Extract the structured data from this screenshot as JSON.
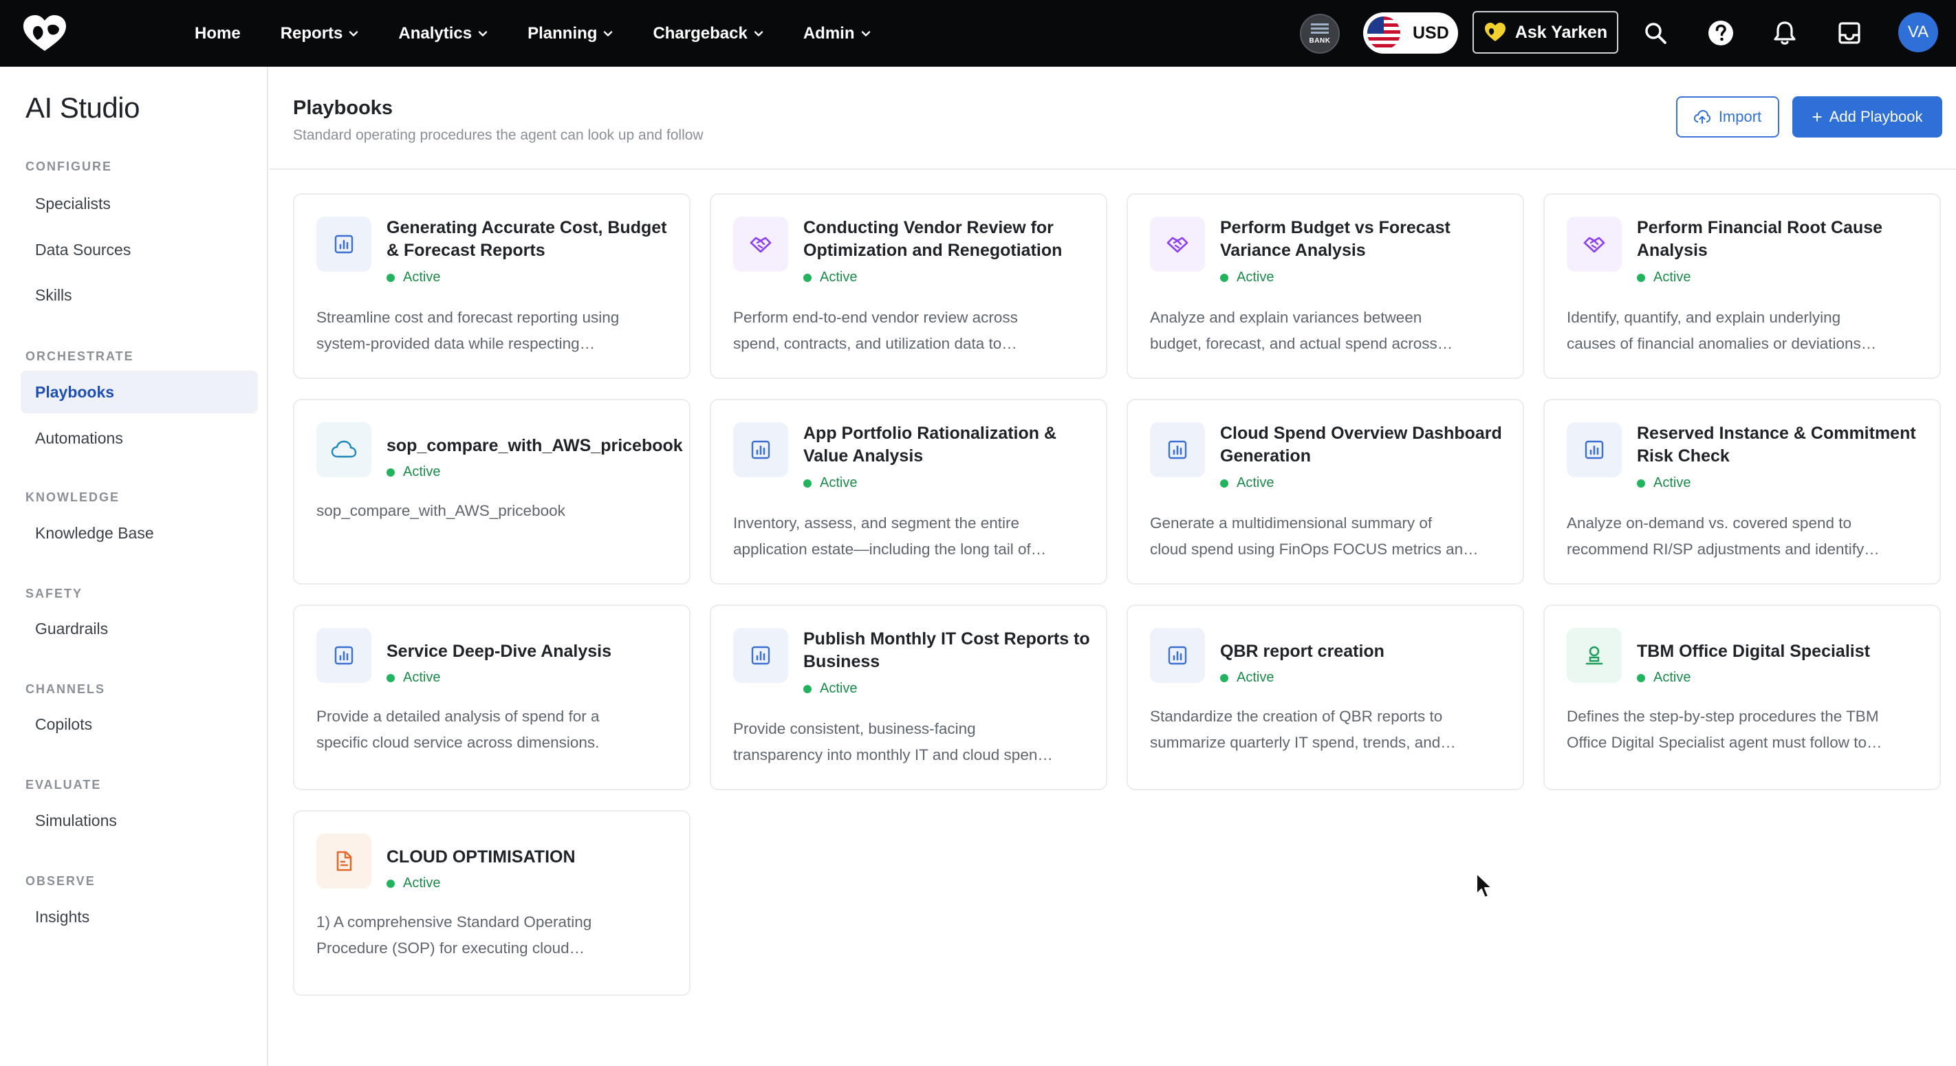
{
  "nav": {
    "items": [
      {
        "label": "Home",
        "has_menu": false
      },
      {
        "label": "Reports",
        "has_menu": true
      },
      {
        "label": "Analytics",
        "has_menu": true
      },
      {
        "label": "Planning",
        "has_menu": true
      },
      {
        "label": "Chargeback",
        "has_menu": true
      },
      {
        "label": "Admin",
        "has_menu": true
      }
    ],
    "bank_badge": "BANK",
    "currency": "USD",
    "ask_label": "Ask Yarken",
    "avatar_initials": "VA",
    "icons": [
      "search-icon",
      "help-icon",
      "bell-icon",
      "inbox-icon"
    ]
  },
  "sidebar": {
    "title": "AI Studio",
    "sections": [
      {
        "heading": "CONFIGURE",
        "items": [
          "Specialists",
          "Data Sources",
          "Skills"
        ]
      },
      {
        "heading": "ORCHESTRATE",
        "items": [
          "Playbooks",
          "Automations"
        ]
      },
      {
        "heading": "KNOWLEDGE",
        "items": [
          "Knowledge Base"
        ]
      },
      {
        "heading": "SAFETY",
        "items": [
          "Guardrails"
        ]
      },
      {
        "heading": "CHANNELS",
        "items": [
          "Copilots"
        ]
      },
      {
        "heading": "EVALUATE",
        "items": [
          "Simulations"
        ]
      },
      {
        "heading": "OBSERVE",
        "items": [
          "Insights"
        ]
      }
    ],
    "active_item": "Playbooks"
  },
  "page": {
    "title": "Playbooks",
    "subtitle": "Standard operating procedures the agent can look up and follow",
    "import_label": "Import",
    "add_label": "Add Playbook"
  },
  "status_active_color": "#22b35e",
  "accent_color": "#2f6fd8",
  "playbooks": [
    {
      "title": "Generating Accurate Cost, Budget & Forecast Reports",
      "status": "Active",
      "icon": "chart-icon",
      "icon_color": "blue",
      "desc": [
        "Streamline cost and forecast reporting using",
        "system-provided data while respecting…"
      ]
    },
    {
      "title": "Conducting Vendor Review for Optimization and Renegotiation",
      "status": "Active",
      "icon": "handshake-icon",
      "icon_color": "purple",
      "desc": [
        "Perform end-to-end vendor review across",
        "spend, contracts, and utilization data to…"
      ]
    },
    {
      "title": "Perform Budget vs Forecast Variance Analysis",
      "status": "Active",
      "icon": "handshake-icon",
      "icon_color": "purple",
      "desc": [
        "Analyze and explain variances between",
        "budget, forecast, and actual spend across…"
      ]
    },
    {
      "title": "Perform Financial Root Cause Analysis",
      "status": "Active",
      "icon": "handshake-icon",
      "icon_color": "purple",
      "desc": [
        "Identify, quantify, and explain underlying",
        "causes of financial anomalies or deviations…"
      ]
    },
    {
      "title": "sop_compare_with_AWS_pricebook",
      "status": "Active",
      "icon": "cloud-icon",
      "icon_color": "teal",
      "desc": [
        "sop_compare_with_AWS_pricebook"
      ]
    },
    {
      "title": "App Portfolio Rationalization & Value Analysis",
      "status": "Active",
      "icon": "chart-icon",
      "icon_color": "blue",
      "desc": [
        "Inventory, assess, and segment the entire",
        "application estate—including the long tail of…"
      ]
    },
    {
      "title": "Cloud Spend Overview Dashboard Generation",
      "status": "Active",
      "icon": "chart-icon",
      "icon_color": "blue",
      "desc": [
        "Generate a multidimensional summary of",
        "cloud spend using FinOps FOCUS metrics an…"
      ]
    },
    {
      "title": "Reserved Instance & Commitment Risk Check",
      "status": "Active",
      "icon": "chart-icon",
      "icon_color": "blue",
      "desc": [
        "Analyze on-demand vs. covered spend to",
        "recommend RI/SP adjustments and identify…"
      ]
    },
    {
      "title": "Service Deep-Dive Analysis",
      "status": "Active",
      "icon": "chart-icon",
      "icon_color": "blue",
      "desc": [
        "Provide a detailed analysis of spend for a",
        "specific cloud service across dimensions."
      ]
    },
    {
      "title": "Publish Monthly IT Cost Reports to Business",
      "status": "Active",
      "icon": "chart-icon",
      "icon_color": "blue",
      "desc": [
        "Provide consistent, business-facing",
        "transparency into monthly IT and cloud spen…"
      ]
    },
    {
      "title": "QBR report creation",
      "status": "Active",
      "icon": "chart-icon",
      "icon_color": "blue",
      "desc": [
        "Standardize the creation of QBR reports to",
        "summarize quarterly IT spend, trends, and…"
      ]
    },
    {
      "title": "TBM Office Digital Specialist",
      "status": "Active",
      "icon": "person-badge-icon",
      "icon_color": "green",
      "desc": [
        "Defines the step-by-step procedures the TBM",
        "Office Digital Specialist agent must follow to…"
      ]
    },
    {
      "title": "CLOUD OPTIMISATION",
      "status": "Active",
      "icon": "document-icon",
      "icon_color": "orange",
      "desc": [
        "1) A comprehensive Standard Operating",
        "Procedure (SOP) for executing cloud…"
      ]
    }
  ]
}
